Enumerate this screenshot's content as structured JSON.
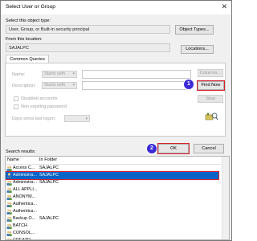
{
  "window": {
    "title": "Select User or Group"
  },
  "object_type": {
    "label": "Select this object type:",
    "value": "User, Group, or Built-in security principal",
    "button": "Object Types..."
  },
  "location": {
    "label": "From this location:",
    "value": "SAJALPC",
    "button": "Locations..."
  },
  "tab": {
    "label": "Common Queries"
  },
  "query": {
    "name_label": "Name:",
    "name_op": "Starts with",
    "desc_label": "Description:",
    "desc_op": "Starts with",
    "disabled_label": "Disabled accounts",
    "nonexpiring_label": "Non expiring password",
    "days_label": "Days since last logon:"
  },
  "buttons": {
    "columns": "Columns...",
    "find_now": "Find Now",
    "stop": "Stop",
    "ok": "OK",
    "cancel": "Cancel"
  },
  "badges": {
    "b1": "1",
    "b2": "2",
    "b3": "3"
  },
  "results": {
    "label": "Search results:",
    "col_name": "Name",
    "col_folder": "In Folder",
    "rows": [
      {
        "name": "Access C...",
        "folder": "SAJALPC",
        "icon": "group-icon"
      },
      {
        "name": "Administra...",
        "folder": "SAJALPC",
        "icon": "user-icon",
        "selected": true
      },
      {
        "name": "Administra...",
        "folder": "SAJALPC",
        "icon": "group-icon"
      },
      {
        "name": "ALL APPLI...",
        "folder": "",
        "icon": "group-icon"
      },
      {
        "name": "ANONYM...",
        "folder": "",
        "icon": "group-icon"
      },
      {
        "name": "Authentica...",
        "folder": "",
        "icon": "group-icon"
      },
      {
        "name": "Authentica...",
        "folder": "",
        "icon": "group-icon"
      },
      {
        "name": "Backup O...",
        "folder": "SAJALPC",
        "icon": "group-icon"
      },
      {
        "name": "BATCH",
        "folder": "",
        "icon": "group-icon"
      },
      {
        "name": "CONSOL...",
        "folder": "",
        "icon": "group-icon"
      },
      {
        "name": "CREATO...",
        "folder": "",
        "icon": "group-icon"
      }
    ]
  }
}
